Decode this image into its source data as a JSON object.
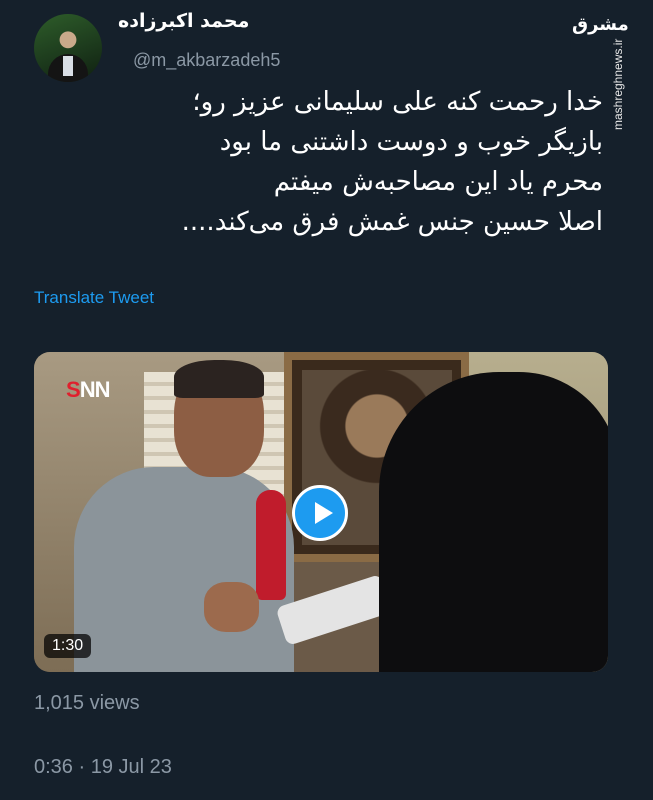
{
  "author": {
    "display_name": "محمد اکبرزاده",
    "handle": "@m_akbarzadeh5"
  },
  "watermark": {
    "logo": "مشرق",
    "site": "mashreghnews.ir"
  },
  "tweet": {
    "lines": [
      "خدا رحمت کنه علی سلیمانی عزیز رو؛",
      "بازیگر خوب و دوست داشتنی ما بود",
      "محرم یاد این مصاحبه‌ش میفتم",
      "اصلا حسین جنس غمش فرق می‌کند...."
    ],
    "translate_label": "Translate Tweet"
  },
  "media": {
    "channel_logo_s": "S",
    "channel_logo_nn": "NN",
    "duration": "1:30",
    "play_icon": "play-icon"
  },
  "stats": {
    "views": "1,015 views",
    "timestamp": "0:36 · 19 Jul 23"
  },
  "colors": {
    "background": "#15202b",
    "accent": "#1d9bf0",
    "secondary_text": "#8b98a5"
  }
}
